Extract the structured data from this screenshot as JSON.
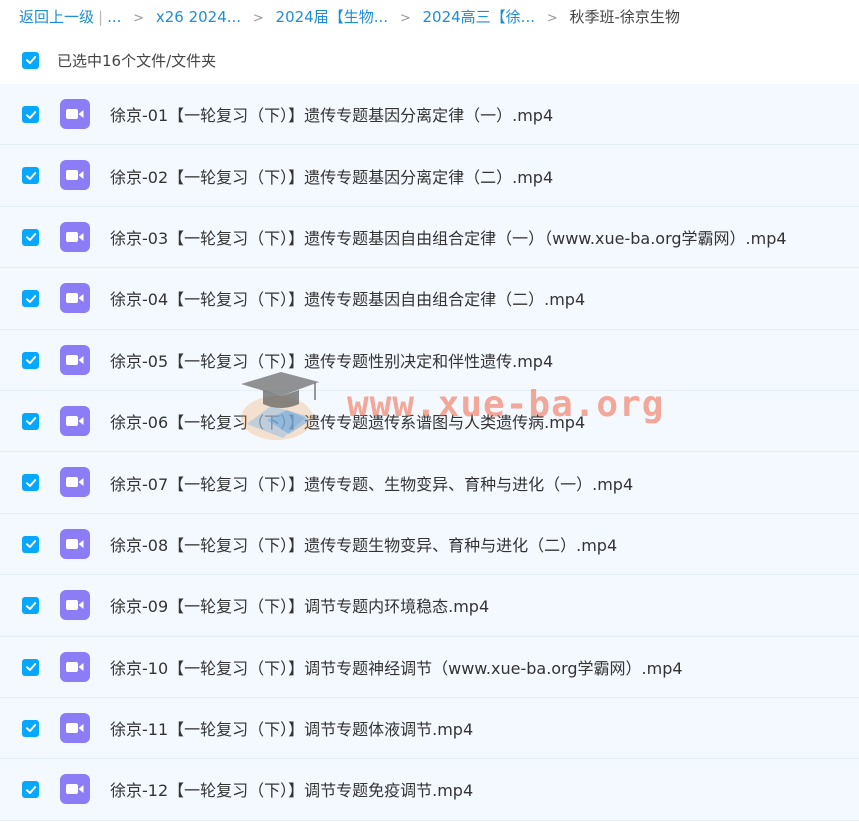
{
  "breadcrumb": {
    "back_label": "返回上一级",
    "pipe": "|",
    "ellipsis": "...",
    "items": [
      "x26 2024...",
      "2024届【生物...",
      "2024高三【徐...",
      "秋季班-徐京生物"
    ]
  },
  "selection": {
    "label": "已选中16个文件/文件夹",
    "checked": true
  },
  "files": [
    {
      "name": "徐京-01【一轮复习（下）】遗传专题基因分离定律（一）.mp4",
      "checked": true,
      "icon": "video-file-icon"
    },
    {
      "name": "徐京-02【一轮复习（下）】遗传专题基因分离定律（二）.mp4",
      "checked": true,
      "icon": "video-file-icon"
    },
    {
      "name": "徐京-03【一轮复习（下）】遗传专题基因自由组合定律（一）（www.xue-ba.org学霸网）.mp4",
      "checked": true,
      "icon": "video-file-icon"
    },
    {
      "name": "徐京-04【一轮复习（下）】遗传专题基因自由组合定律（二）.mp4",
      "checked": true,
      "icon": "video-file-icon"
    },
    {
      "name": "徐京-05【一轮复习（下）】遗传专题性别决定和伴性遗传.mp4",
      "checked": true,
      "icon": "video-file-icon"
    },
    {
      "name": "徐京-06【一轮复习（下）】遗传专题遗传系谱图与人类遗传病.mp4",
      "checked": true,
      "icon": "video-file-icon"
    },
    {
      "name": "徐京-07【一轮复习（下）】遗传专题、生物变异、育种与进化（一）.mp4",
      "checked": true,
      "icon": "video-file-icon"
    },
    {
      "name": "徐京-08【一轮复习（下）】遗传专题生物变异、育种与进化（二）.mp4",
      "checked": true,
      "icon": "video-file-icon"
    },
    {
      "name": "徐京-09【一轮复习（下）】调节专题内环境稳态.mp4",
      "checked": true,
      "icon": "video-file-icon"
    },
    {
      "name": "徐京-10【一轮复习（下）】调节专题神经调节（www.xue-ba.org学霸网）.mp4",
      "checked": true,
      "icon": "video-file-icon"
    },
    {
      "name": "徐京-11【一轮复习（下）】调节专题体液调节.mp4",
      "checked": true,
      "icon": "video-file-icon"
    },
    {
      "name": "徐京-12【一轮复习（下）】调节专题免疫调节.mp4",
      "checked": true,
      "icon": "video-file-icon"
    }
  ],
  "watermark": {
    "text": "www.xue-ba.org",
    "icon": "graduation-cap-logo-icon"
  },
  "colors": {
    "accent": "#06a7ff",
    "link": "#1e8ed4",
    "video_icon": "#8c7cf6",
    "row_bg": "#f4f9ff"
  }
}
